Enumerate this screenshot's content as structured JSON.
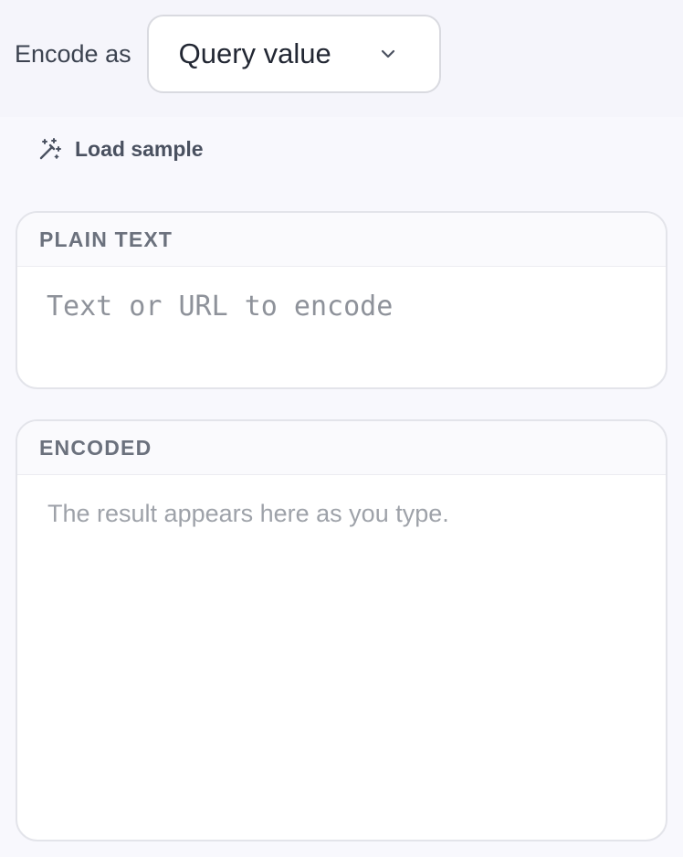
{
  "encode": {
    "label": "Encode as",
    "selected": "Query value"
  },
  "actions": {
    "load_sample": "Load sample"
  },
  "plain_panel": {
    "title": "PLAIN TEXT",
    "value": "",
    "placeholder": "Text or URL to encode"
  },
  "encoded_panel": {
    "title": "ENCODED",
    "placeholder": "The result appears here as you type."
  },
  "icons": {
    "dropdown": "chevron-down-icon",
    "load_sample": "magic-wand-icon"
  }
}
